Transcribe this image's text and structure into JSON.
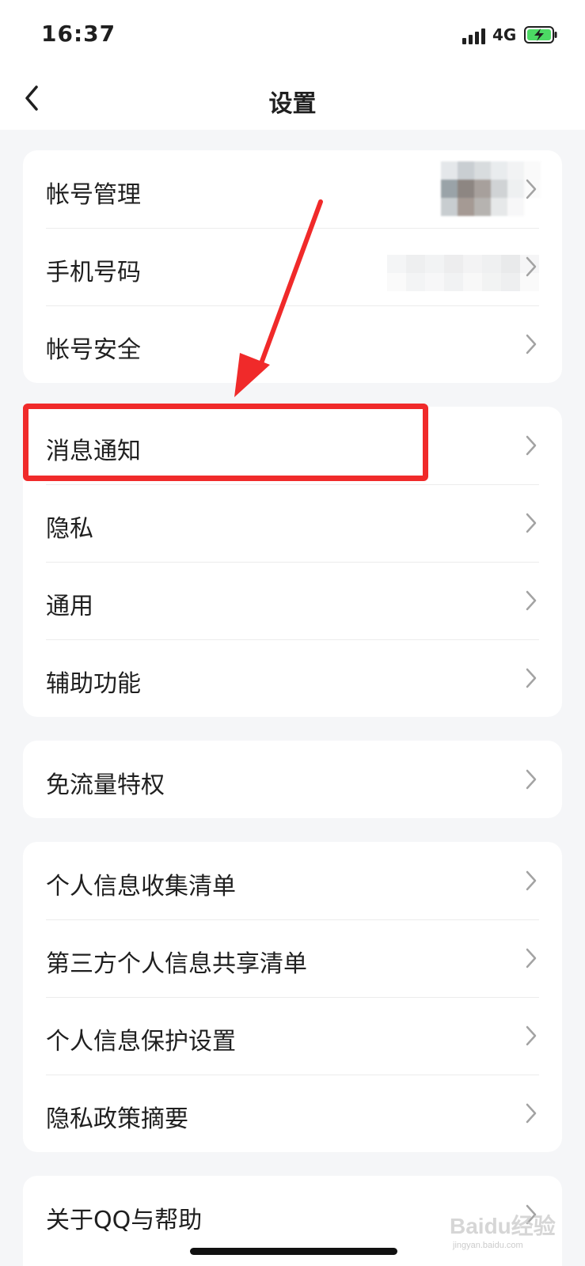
{
  "status_bar": {
    "time": "16:37",
    "network": "4G"
  },
  "nav": {
    "title": "设置"
  },
  "groups": [
    {
      "items": [
        {
          "label": "帐号管理"
        },
        {
          "label": "手机号码"
        },
        {
          "label": "帐号安全"
        }
      ]
    },
    {
      "items": [
        {
          "label": "消息通知"
        },
        {
          "label": "隐私"
        },
        {
          "label": "通用"
        },
        {
          "label": "辅助功能"
        }
      ]
    },
    {
      "items": [
        {
          "label": "免流量特权"
        }
      ]
    },
    {
      "items": [
        {
          "label": "个人信息收集清单"
        },
        {
          "label": "第三方个人信息共享清单"
        },
        {
          "label": "个人信息保护设置"
        },
        {
          "label": "隐私政策摘要"
        }
      ]
    },
    {
      "items": [
        {
          "label": "关于QQ与帮助"
        }
      ]
    }
  ],
  "icons": {
    "back": "chevron-left-icon",
    "row_arrow": "chevron-right-icon"
  },
  "colors": {
    "annotation": "#f02a2a",
    "background": "#f5f6f8",
    "battery": "#4cd964"
  },
  "watermark": {
    "brand": "Baidu经验",
    "url": "jingyan.baidu.com"
  }
}
